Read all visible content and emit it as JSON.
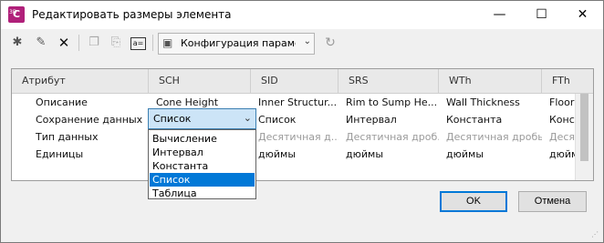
{
  "window": {
    "title": "Редактировать размеры элемента",
    "app_icon": {
      "letter": "C",
      "mini": "3D",
      "name": "civil3d-app-icon",
      "color": "#b0207a"
    },
    "controls": {
      "minimize": "—",
      "maximize": "☐",
      "close": "✕"
    }
  },
  "toolbar": {
    "icons": {
      "new": "✱",
      "edit": "✎",
      "delete": "✕",
      "copy": "❐",
      "paste": "⎘",
      "rename": "a=",
      "refresh": "↻"
    },
    "configuration_label": "Конфигурация параме",
    "configuration_icon": "▣",
    "dropdown_arrow": "⌄"
  },
  "grid": {
    "columns": [
      "Атрибут",
      "SCH",
      "SID",
      "SRS",
      "WTh",
      "FTh"
    ],
    "rows": [
      {
        "label": "Описание",
        "cells": [
          "Cone Height",
          "Inner Structur...",
          "Rim to Sump He...",
          "Wall Thickness",
          "Floor"
        ]
      },
      {
        "label": "Сохранение данных",
        "cells": [
          "Список",
          "Список",
          "Интервал",
          "Константа",
          "Конс"
        ]
      },
      {
        "label": "Тип данных",
        "cells": [
          "",
          "Десятичная д...",
          "Десятичная дроб...",
          "Десятичная дробь",
          "Деся"
        ]
      },
      {
        "label": "Единицы",
        "cells": [
          "",
          "дюймы",
          "дюймы",
          "дюймы",
          "дюйм"
        ]
      }
    ]
  },
  "combo": {
    "value": "Список",
    "arrow": "⌄",
    "options": [
      "Вычисление",
      "Интервал",
      "Константа",
      "Список",
      "Таблица"
    ],
    "selected_index": 3
  },
  "buttons": {
    "ok": "OK",
    "cancel": "Отмена"
  },
  "colors": {
    "accent": "#0078d7",
    "combo_bg": "#cce4f7"
  }
}
